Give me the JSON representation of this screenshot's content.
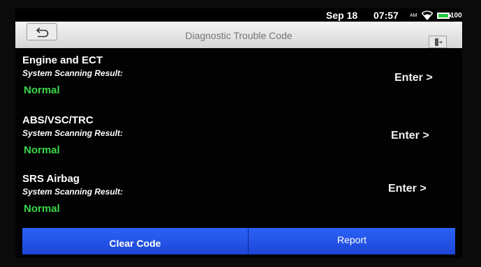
{
  "status_bar": {
    "date": "Sep 18",
    "time": "07:57",
    "ampm": "AM",
    "battery_text": "100%",
    "battery_level": 1.0,
    "battery_color": "#27c93f"
  },
  "header": {
    "title": "Diagnostic Trouble Code",
    "back_icon": "back-arrow-icon",
    "exit_icon": "exit-door-icon"
  },
  "systems": [
    {
      "name": "Engine and ECT",
      "subtitle": "System Scanning Result:",
      "status": "Normal",
      "enter": "Enter >"
    },
    {
      "name": "ABS/VSC/TRC",
      "subtitle": "System Scanning Result:",
      "status": "Normal",
      "enter": "Enter >"
    },
    {
      "name": "SRS Airbag",
      "subtitle": "System Scanning Result:",
      "status": "Normal",
      "enter": "Enter >"
    }
  ],
  "footer": {
    "clear_code": "Clear Code",
    "report": "Report",
    "button_color": "#2a62f7"
  },
  "colors": {
    "status_ok": "#3ad64a"
  }
}
